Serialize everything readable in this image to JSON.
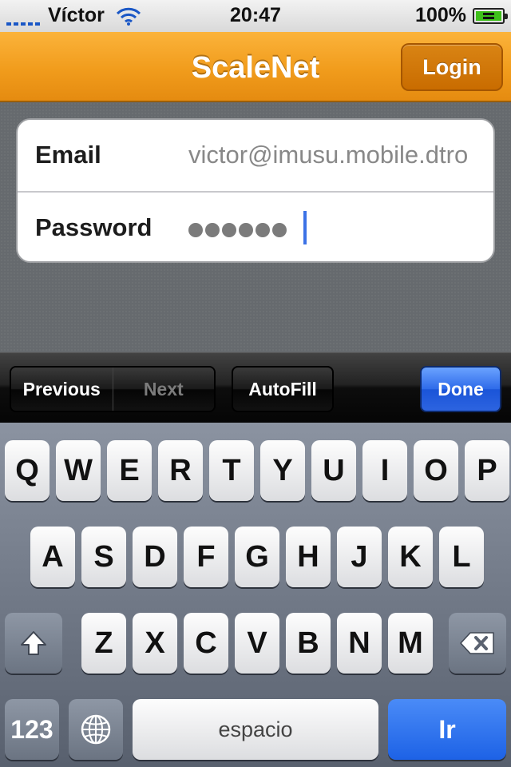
{
  "status_bar": {
    "carrier": "Víctor",
    "time": "20:47",
    "battery": "100%",
    "signal_icon": "signal-bars-icon",
    "wifi_icon": "wifi-icon",
    "battery_icon": "battery-charging-icon"
  },
  "nav": {
    "title": "ScaleNet",
    "login_label": "Login"
  },
  "form": {
    "email_label": "Email",
    "email_value": "victor@imusu.mobile.dtro",
    "password_label": "Password",
    "password_mask": "●●●●●●"
  },
  "toolbar": {
    "previous": "Previous",
    "next": "Next",
    "autofill": "AutoFill",
    "done": "Done"
  },
  "keyboard": {
    "row1": [
      "Q",
      "W",
      "E",
      "R",
      "T",
      "Y",
      "U",
      "I",
      "O",
      "P"
    ],
    "row2": [
      "A",
      "S",
      "D",
      "F",
      "G",
      "H",
      "J",
      "K",
      "L"
    ],
    "row3": [
      "Z",
      "X",
      "C",
      "V",
      "B",
      "N",
      "M"
    ],
    "numbers": "123",
    "space": "espacio",
    "go": "Ir",
    "shift_icon": "shift-icon",
    "delete_icon": "backspace-icon",
    "globe_icon": "globe-icon"
  },
  "colors": {
    "nav_orange": "#f19c1c",
    "login_orange": "#c96c00",
    "done_blue": "#2e6be9",
    "cursor_blue": "#3b72e6"
  }
}
